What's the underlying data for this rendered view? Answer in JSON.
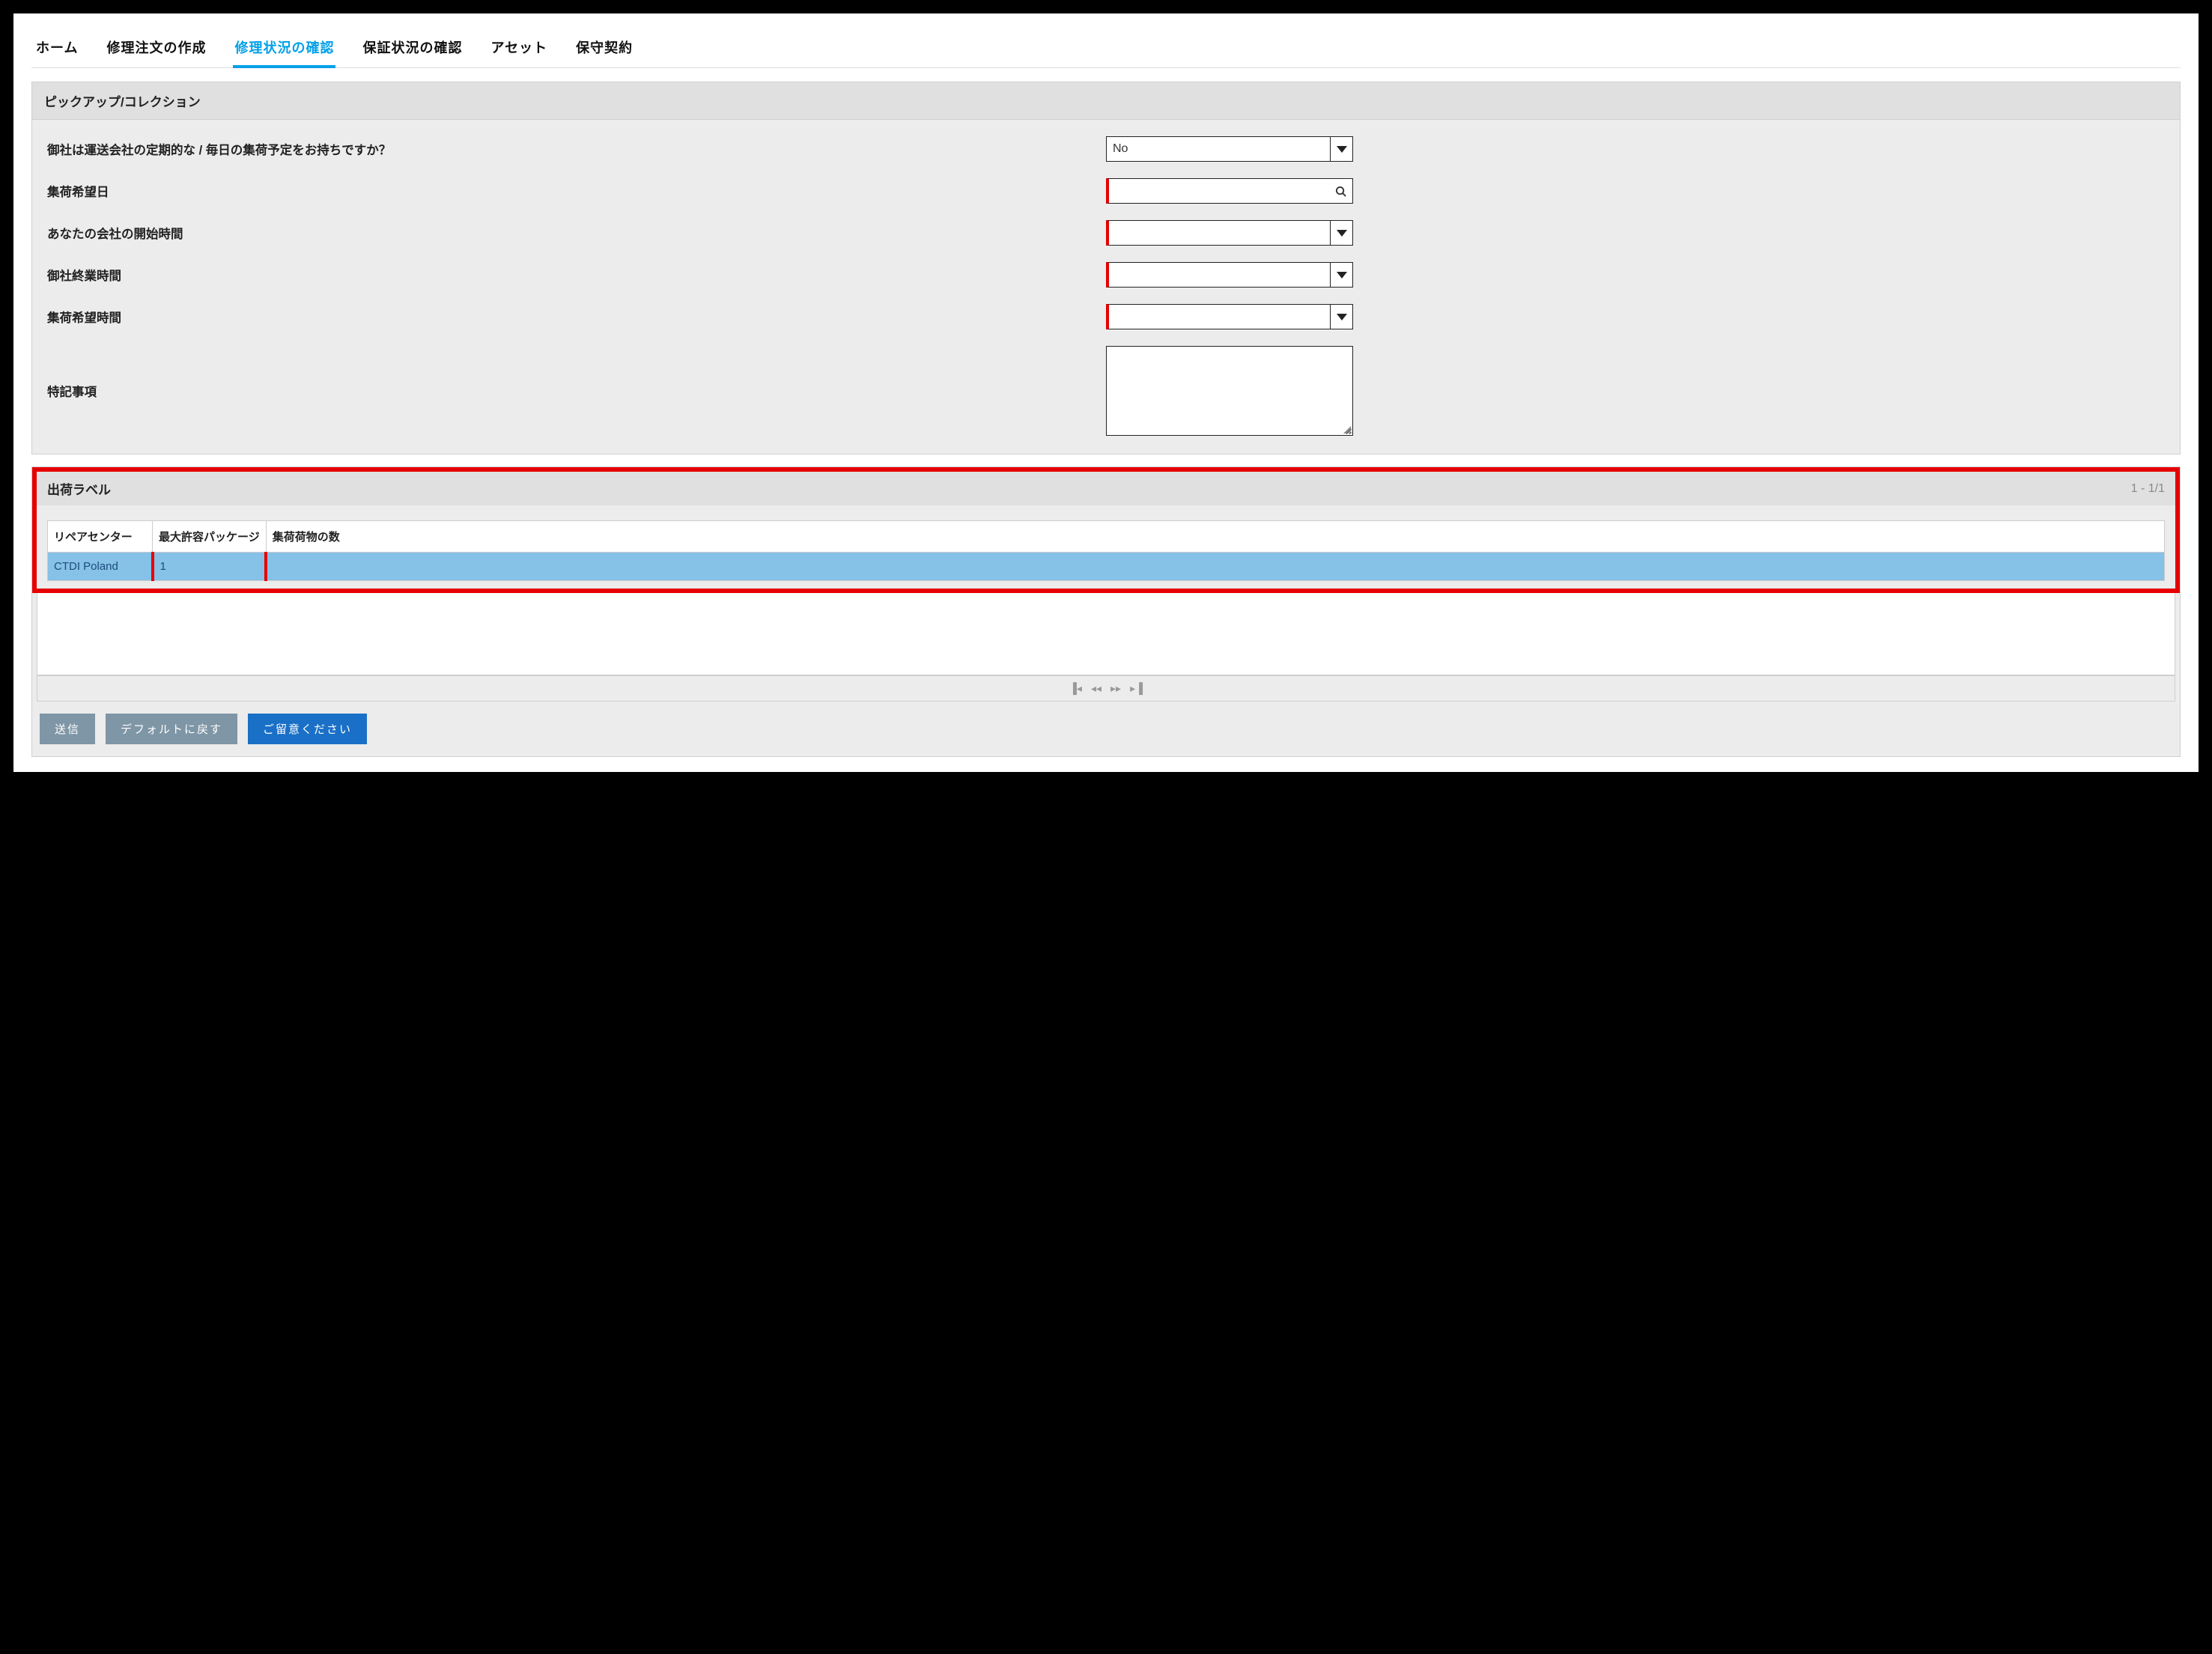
{
  "tabs": [
    {
      "label": "ホーム",
      "active": false
    },
    {
      "label": "修理注文の作成",
      "active": false
    },
    {
      "label": "修理状況の確認",
      "active": true
    },
    {
      "label": "保証状況の確認",
      "active": false
    },
    {
      "label": "アセット",
      "active": false
    },
    {
      "label": "保守契約",
      "active": false
    }
  ],
  "pickup": {
    "title": "ピックアップ/コレクション",
    "fields": {
      "carrier_schedule": {
        "label": "御社は運送会社の定期的な / 毎日の集荷予定をお持ちですか？",
        "value": "No"
      },
      "desired_pickup_date": {
        "label": "集荷希望日",
        "value": ""
      },
      "company_open": {
        "label": "あなたの会社の開始時間",
        "value": ""
      },
      "company_close": {
        "label": "御社終業時間",
        "value": ""
      },
      "desired_pickup_time": {
        "label": "集荷希望時間",
        "value": ""
      },
      "notes": {
        "label": "特記事項",
        "value": ""
      }
    }
  },
  "ship_label": {
    "title": "出荷ラベル",
    "page_counter": "1 - 1/1",
    "columns": {
      "repair_center": "リペアセンター",
      "max_package": "最大許容パッケージ",
      "num_packages": "集荷荷物の数"
    },
    "rows": [
      {
        "repair_center": "CTDI Poland",
        "max_package": "1",
        "num_packages": ""
      }
    ]
  },
  "buttons": {
    "submit": "送信",
    "reset": "デフォルトに戻す",
    "notice": "ご留意ください"
  }
}
